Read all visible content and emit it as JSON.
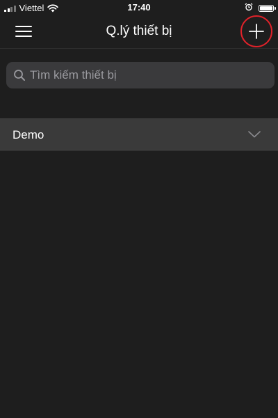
{
  "status_bar": {
    "carrier": "Viettel",
    "time": "17:40",
    "signal_bars": 2,
    "battery_level": 1.0
  },
  "nav": {
    "title": "Q.lý thiết bị",
    "menu_icon": "hamburger-menu-icon",
    "add_icon": "plus-icon",
    "highlight_color": "#e0222a"
  },
  "search": {
    "placeholder": "Tìm kiếm thiết bị",
    "value": "",
    "icon": "search-icon"
  },
  "groups": [
    {
      "label": "Demo",
      "icon": "chevron-down-icon",
      "expanded": false
    }
  ],
  "colors": {
    "background": "#1e1e1e",
    "search_bg": "#3a3a3c",
    "row_bg": "#3a3a3a"
  }
}
